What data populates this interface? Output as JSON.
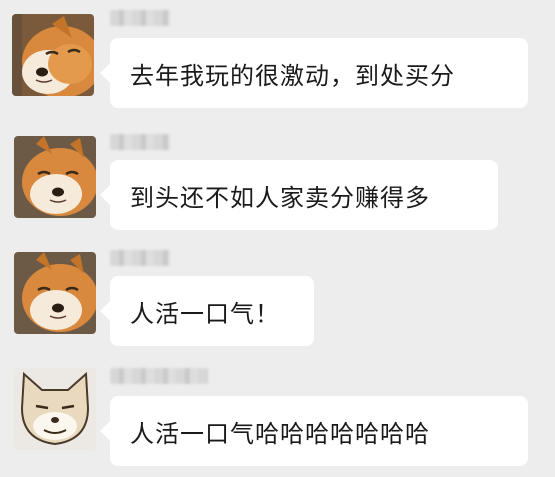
{
  "messages": [
    {
      "sender_name": "",
      "avatar_icon": "shiba-dog-icon",
      "text": "去年我玩的很激动，到处买分"
    },
    {
      "sender_name": "",
      "avatar_icon": "shiba-dog-icon",
      "text": "到头还不如人家卖分赚得多"
    },
    {
      "sender_name": "",
      "avatar_icon": "shiba-dog-icon",
      "text": "人活一口气！"
    },
    {
      "sender_name": "",
      "avatar_icon": "smug-dog-cartoon-icon",
      "text": "人活一口气哈哈哈哈哈哈哈"
    }
  ],
  "colors": {
    "background": "#ededed",
    "bubble": "#ffffff",
    "text": "#1a1a1a"
  }
}
